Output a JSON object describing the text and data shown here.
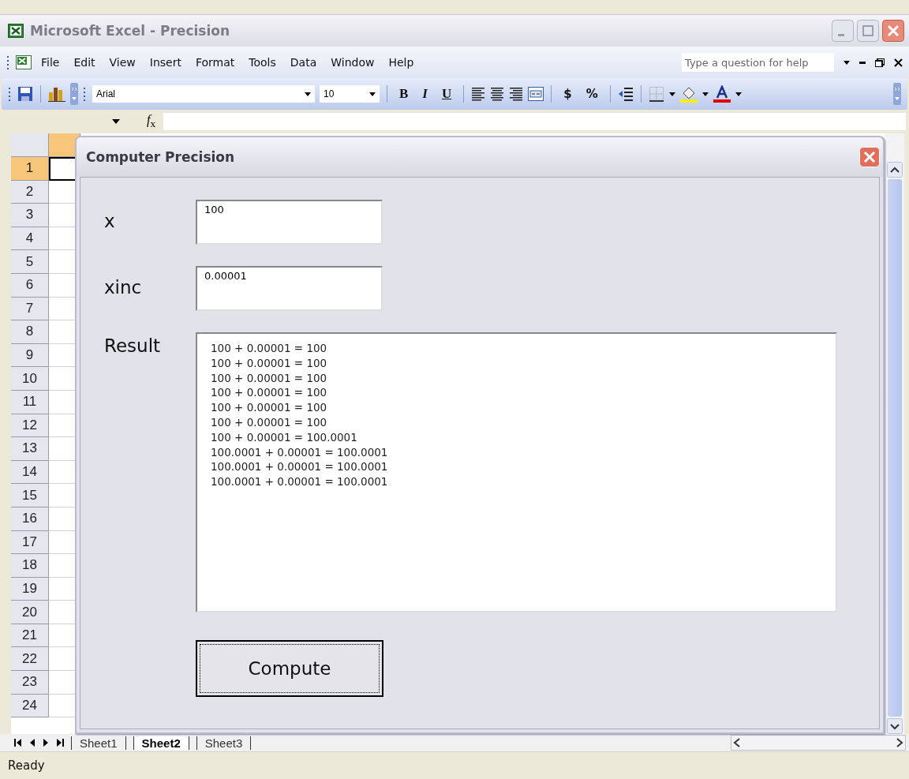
{
  "window": {
    "title": "Microsoft Excel - Precision"
  },
  "menu": [
    "File",
    "Edit",
    "View",
    "Insert",
    "Format",
    "Tools",
    "Data",
    "Window",
    "Help"
  ],
  "help_box": {
    "placeholder": "Type a question for help"
  },
  "toolbar": {
    "font": "Arial",
    "size": "10",
    "bold": "B",
    "italic": "I",
    "underline": "U",
    "currency": "$",
    "percent": "%"
  },
  "formula_bar": {
    "function_label": "*f*$_{x}$"
  },
  "rows": [
    {
      "label": "1",
      "selected": true
    },
    {
      "label": "2",
      "selected": false
    },
    {
      "label": "3",
      "selected": false
    },
    {
      "label": "4",
      "selected": false
    },
    {
      "label": "5",
      "selected": false
    },
    {
      "label": "6",
      "selected": false
    },
    {
      "label": "7",
      "selected": false
    },
    {
      "label": "8",
      "selected": false
    },
    {
      "label": "9",
      "selected": false
    },
    {
      "label": "10",
      "selected": false
    },
    {
      "label": "11",
      "selected": false
    },
    {
      "label": "12",
      "selected": false
    },
    {
      "label": "13",
      "selected": false
    },
    {
      "label": "14",
      "selected": false
    },
    {
      "label": "15",
      "selected": false
    },
    {
      "label": "16",
      "selected": false
    },
    {
      "label": "17",
      "selected": false
    },
    {
      "label": "18",
      "selected": false
    },
    {
      "label": "19",
      "selected": false
    },
    {
      "label": "20",
      "selected": false
    },
    {
      "label": "21",
      "selected": false
    },
    {
      "label": "22",
      "selected": false
    },
    {
      "label": "23",
      "selected": false
    },
    {
      "label": "24",
      "selected": false
    }
  ],
  "dialog": {
    "title": "Computer Precision",
    "fields": [
      {
        "label": "x",
        "value": "100"
      },
      {
        "label": "xinc",
        "value": "0.00001"
      }
    ],
    "result_label": "Result",
    "result_lines": [
      "100 + 0.00001 = 100",
      "100 + 0.00001 = 100",
      "100 + 0.00001 = 100",
      "100 + 0.00001 = 100",
      "100 + 0.00001 = 100",
      "100 + 0.00001 = 100",
      "100 + 0.00001 = 100.0001",
      "100.0001 + 0.00001 = 100.0001",
      "100.0001 + 0.00001 = 100.0001",
      "100.0001 + 0.00001 = 100.0001"
    ],
    "button": "Compute"
  },
  "sheet_tabs": [
    {
      "label": "Sheet1",
      "selected": false
    },
    {
      "label": "Sheet2",
      "selected": true
    },
    {
      "label": "Sheet3",
      "selected": false
    }
  ],
  "status_bar": "Ready"
}
